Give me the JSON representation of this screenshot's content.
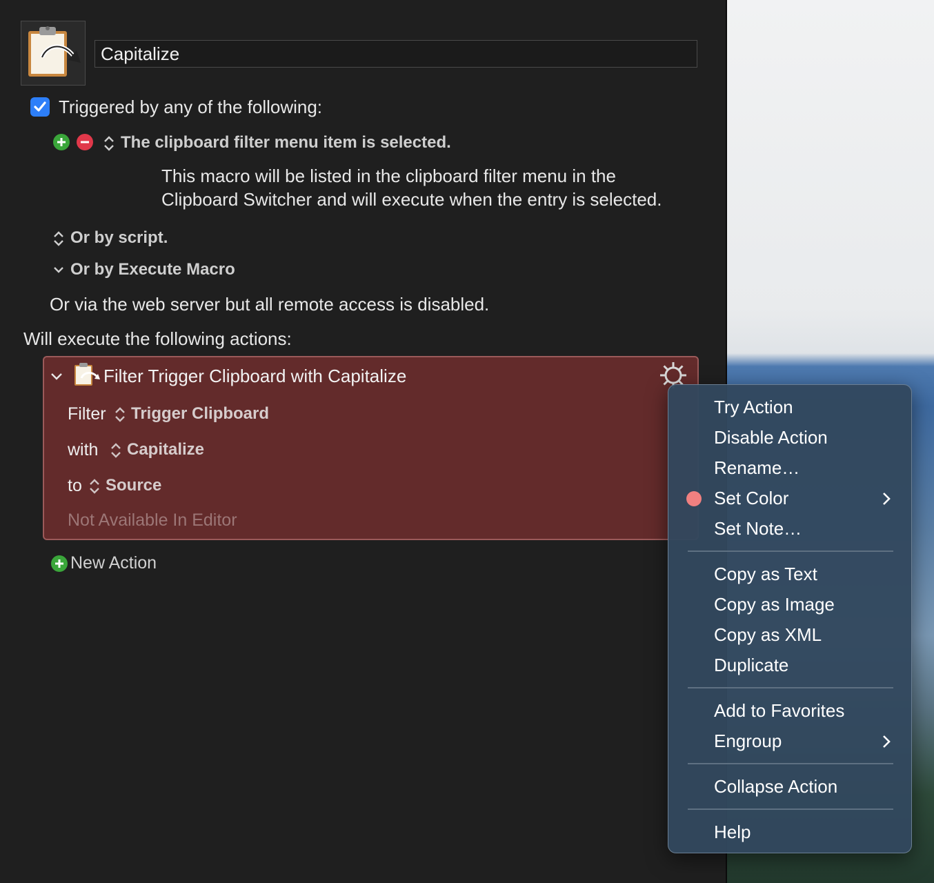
{
  "macro": {
    "name": "Capitalize",
    "trigger_enabled": true,
    "trigger_header": "Triggered by any of the following:",
    "trigger_title": "The clipboard filter menu item is selected.",
    "trigger_desc_line1": "This macro will be listed in the clipboard filter menu in the",
    "trigger_desc_line2": "Clipboard Switcher and will execute when the entry is selected.",
    "or_script": "Or by script.",
    "or_execute_macro": "Or by Execute Macro",
    "web_server_note": "Or via the web server but all remote access is disabled.",
    "actions_header": "Will execute the following actions:",
    "new_action": "New Action"
  },
  "action": {
    "title": "Filter Trigger Clipboard with Capitalize",
    "filter_label": "Filter",
    "filter_value": "Trigger Clipboard",
    "with_label": "with",
    "with_value": "Capitalize",
    "to_label": "to",
    "to_value": "Source",
    "note": "Not Available In Editor"
  },
  "context_menu": {
    "items": [
      "Try Action",
      "Disable Action",
      "Rename…",
      "Set Color",
      "Set Note…",
      "Copy as Text",
      "Copy as Image",
      "Copy as XML",
      "Duplicate",
      "Add to Favorites",
      "Engroup",
      "Collapse Action",
      "Help"
    ],
    "set_color_dot": "#f08080"
  },
  "colors": {
    "action_bg": "#632b2b",
    "checkbox_blue": "#2d7ff9",
    "add_green": "#3aa63a",
    "remove_red": "#e0384a"
  }
}
